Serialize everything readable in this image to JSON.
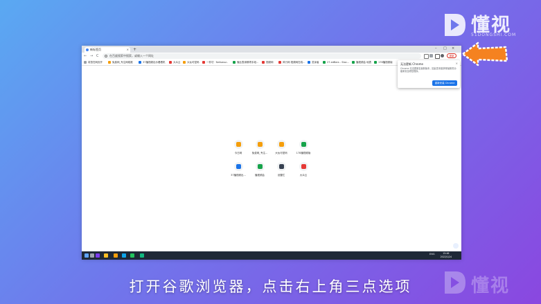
{
  "brand": {
    "name": "懂视",
    "sub": "51DONGSHI.COM",
    "color": "#ffffff"
  },
  "browser": {
    "tab_title": "新标签页",
    "tab_close": "×",
    "new_tab": "+",
    "window_controls": [
      "–",
      "□",
      "×"
    ],
    "nav": {
      "back": "←",
      "forward": "→",
      "reload": "C"
    },
    "omnibox_placeholder": "在百度搜索中搜索，或输入一个网址",
    "update_label": "更新",
    "bookmarks": [
      {
        "label": "将您在网页开",
        "color": "#9aa0a6"
      },
      {
        "label": "免费网_专注网络推",
        "color": "#f59e0b"
      },
      {
        "label": "37播视频出价看看机",
        "color": "#1a73e8"
      },
      {
        "label": "大众云",
        "color": "#e53935"
      },
      {
        "label": "大伙可密码",
        "color": "#f59e0b"
      },
      {
        "label": "一件坊 · Nafuwuz..",
        "color": "#e53935"
      },
      {
        "label": "懂比表用哪项手段...",
        "color": "#16a34a"
      },
      {
        "label": "视频网",
        "color": "#e53935"
      },
      {
        "label": "风行网 视频网在线...",
        "color": "#e53935"
      },
      {
        "label": "范深者",
        "color": "#1a73e8"
      },
      {
        "label": "27.edBars - Stoc...",
        "color": "#16a34a"
      },
      {
        "label": "播视频会 地表",
        "color": "#16a34a"
      },
      {
        "label": "178播视频版",
        "color": "#16a34a"
      }
    ],
    "popup": {
      "title": "无法更新 Chrome",
      "body": "Chrome 无法更新至最新版本，因此您未能获得最新的功能和安全修复程序。",
      "button": "重新安装 Chrome",
      "close": "×"
    },
    "shortcuts": [
      {
        "label": "今日网",
        "color": "#f59e0b"
      },
      {
        "label": "免费网_专注...",
        "color": "#f59e0b"
      },
      {
        "label": "大伙可密码",
        "color": "#f59e0b"
      },
      {
        "label": "178播视频版",
        "color": "#16a34a"
      },
      {
        "label": "37播视频出...",
        "color": "#1a73e8"
      },
      {
        "label": "播视频会",
        "color": "#16a34a"
      },
      {
        "label": "设置栏",
        "color": "#374151"
      },
      {
        "label": "大众云",
        "color": "#e53935"
      }
    ]
  },
  "taskbar": {
    "apps": [
      {
        "name": "start",
        "color": "#60a5fa"
      },
      {
        "name": "search",
        "color": "#9ca3af"
      },
      {
        "name": "premiere",
        "color": "#7c3aed"
      },
      {
        "name": "chrome",
        "color": "#fbbf24"
      },
      {
        "name": "explorer",
        "color": "#f59e0b"
      },
      {
        "name": "edge",
        "color": "#0ea5e9"
      },
      {
        "name": "store",
        "color": "#22c55e"
      },
      {
        "name": "settings",
        "color": "#10b981"
      }
    ],
    "tray_lang": "ENG",
    "time": "15:46",
    "date": "2022/1/24"
  },
  "caption": "打开谷歌浏览器，点击右上角三点选项",
  "colors": {
    "arrow": "#f58220",
    "accent": "#1a73e8",
    "alert": "#d93025"
  }
}
